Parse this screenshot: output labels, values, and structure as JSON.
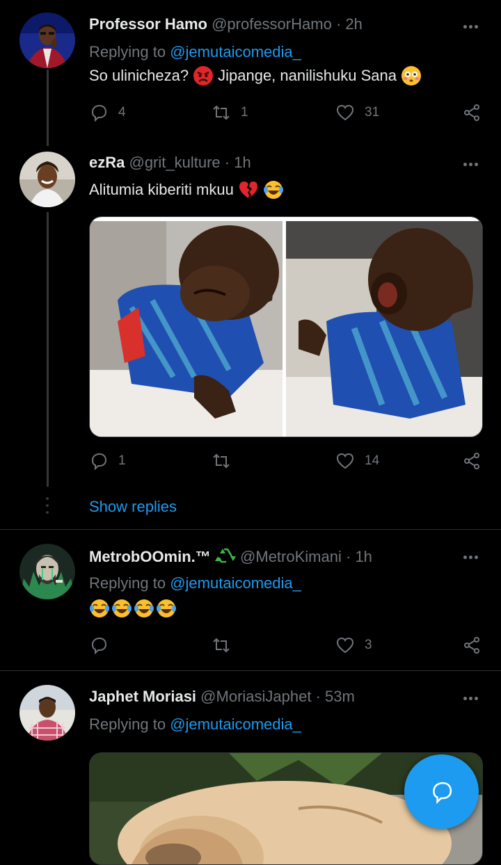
{
  "tweets": [
    {
      "name": "Professor Hamo",
      "handle": "@professorHamo",
      "sep": "·",
      "time": "2h",
      "replying_prefix": "Replying to",
      "replying_to": "@jemutaicomedia_",
      "text_a": "So ulinicheza?",
      "text_b": "Jipange, nanilishuku Sana",
      "replies": "4",
      "retweets": "1",
      "likes": "31"
    },
    {
      "name": "ezRa",
      "handle": "@grit_kulture",
      "sep": "·",
      "time": "1h",
      "text_a": "Alitumia kiberiti mkuu",
      "replies": "1",
      "retweets": "",
      "likes": "14"
    },
    {
      "name": "MetrobOOmin.™",
      "handle": "@MetroKimani",
      "sep": "·",
      "time": "1h",
      "replying_prefix": "Replying to",
      "replying_to": "@jemutaicomedia_",
      "replies": "",
      "retweets": "",
      "likes": "3"
    },
    {
      "name": "Japhet Moriasi",
      "handle": "@MoriasiJaphet",
      "sep": "·",
      "time": "53m",
      "replying_prefix": "Replying to",
      "replying_to": "@jemutaicomedia_"
    }
  ],
  "show_replies": "Show replies",
  "icons": {
    "reply": "reply-icon",
    "retweet": "retweet-icon",
    "like": "heart-icon",
    "share": "share-icon",
    "more": "more-icon",
    "compose": "compose-reply-icon"
  },
  "colors": {
    "background": "#000000",
    "accent": "#1d9bf0",
    "muted": "#71767b",
    "text": "#e7e9ea"
  }
}
